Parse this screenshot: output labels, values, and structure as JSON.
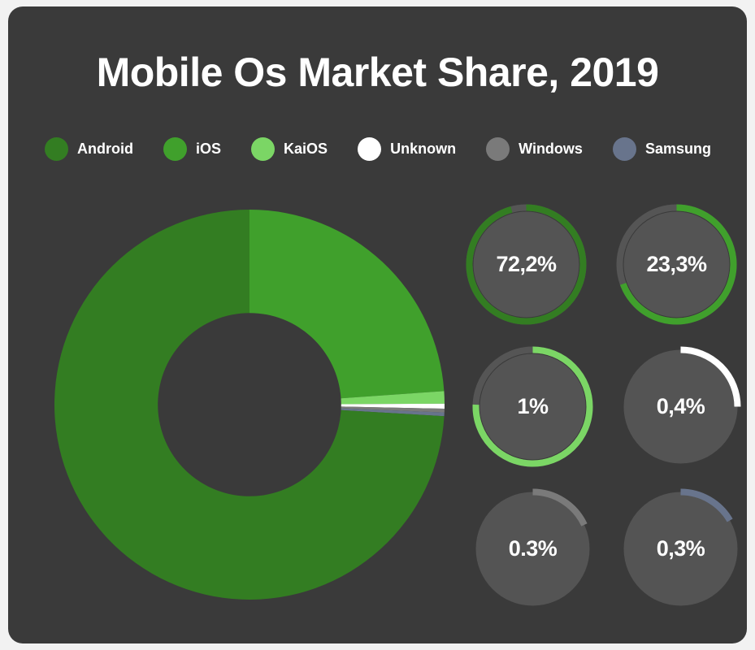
{
  "card": {
    "background": "#3a3a3a",
    "page_background": "#f2f2f2"
  },
  "title": "Mobile Os Market Share, 2019",
  "legend": {
    "items": [
      {
        "label": "Android",
        "color": "#337d22"
      },
      {
        "label": "iOS",
        "color": "#40a02c"
      },
      {
        "label": "KaiOS",
        "color": "#7bd665"
      },
      {
        "label": "Unknown",
        "color": "#ffffff"
      },
      {
        "label": "Windows",
        "color": "#7a7a7a"
      },
      {
        "label": "Samsung",
        "color": "#68748c"
      }
    ]
  },
  "gauges": [
    {
      "name": "android",
      "value_label": "72,2%",
      "color": "#337d22",
      "sweep_deg": 345,
      "track": "#555555",
      "track_visible": true
    },
    {
      "name": "ios",
      "value_label": "23,3%",
      "color": "#40a02c",
      "sweep_deg": 250,
      "track": "#555555",
      "track_visible": true
    },
    {
      "name": "kaios",
      "value_label": "1%",
      "color": "#7bd665",
      "sweep_deg": 272,
      "track": "#555555",
      "track_visible": true
    },
    {
      "name": "unknown",
      "value_label": "0,4%",
      "color": "#ffffff",
      "sweep_deg": 90,
      "track": "#4f4f4f",
      "track_visible": false
    },
    {
      "name": "windows",
      "value_label": "0.3%",
      "color": "#7a7a7a",
      "sweep_deg": 65,
      "track": "#4f4f4f",
      "track_visible": false
    },
    {
      "name": "samsung",
      "value_label": "0,3%",
      "color": "#68748c",
      "sweep_deg": 60,
      "track": "#4f4f4f",
      "track_visible": false
    }
  ],
  "chart_data": {
    "type": "pie",
    "title": "Mobile Os Market Share, 2019",
    "subtype": "donut",
    "start_angle_deg": 0,
    "direction": "clockwise",
    "hole_ratio": 0.47,
    "unit": "percent",
    "labels": [
      "iOS",
      "KaiOS",
      "Unknown",
      "Windows",
      "Samsung",
      "Android"
    ],
    "values": [
      23.3,
      1.0,
      0.4,
      0.3,
      0.3,
      72.2
    ],
    "value_labels": [
      "23,3%",
      "1%",
      "0,4%",
      "0.3%",
      "0,3%",
      "72,2%"
    ],
    "colors": [
      "#40a02c",
      "#7bd665",
      "#ffffff",
      "#7a7a7a",
      "#68748c",
      "#337d22"
    ],
    "legend": [
      "Android",
      "iOS",
      "KaiOS",
      "Unknown",
      "Windows",
      "Samsung"
    ],
    "legend_position": "top",
    "grid": false,
    "xlabel": "",
    "ylabel": ""
  }
}
